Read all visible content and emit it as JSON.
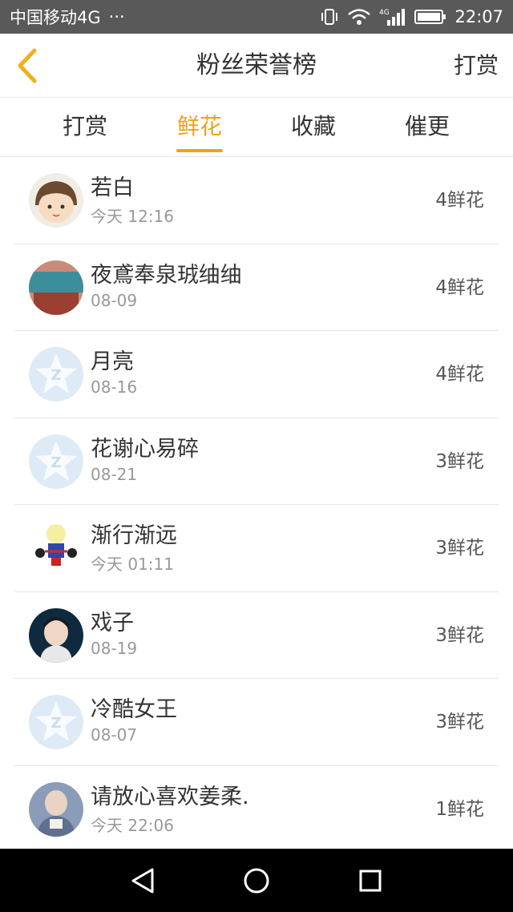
{
  "status_bar": {
    "carrier": "中国移动4G",
    "dots": "···",
    "network": "4G",
    "time": "22:07"
  },
  "header": {
    "title": "粉丝荣誉榜",
    "right_action": "打赏"
  },
  "tabs": [
    {
      "label": "打赏",
      "active": false
    },
    {
      "label": "鲜花",
      "active": true
    },
    {
      "label": "收藏",
      "active": false
    },
    {
      "label": "催更",
      "active": false
    }
  ],
  "accent_color": "#f2a11b",
  "fans": [
    {
      "name": "若白",
      "time": "今天 12:16",
      "count": "4鲜花",
      "avatar": "cartoon-boy-avatar"
    },
    {
      "name": "夜鳶奉泉珬䌷䌷",
      "time": "08-09",
      "count": "4鲜花",
      "avatar": "photo-avatar"
    },
    {
      "name": "月亮",
      "time": "08-16",
      "count": "4鲜花",
      "avatar": "default-star-avatar"
    },
    {
      "name": "花谢心易碎",
      "time": "08-21",
      "count": "3鲜花",
      "avatar": "default-star-avatar"
    },
    {
      "name": "渐行渐远",
      "time": "今天 01:11",
      "count": "3鲜花",
      "avatar": "cartoon-figure-avatar"
    },
    {
      "name": "戏子",
      "time": "08-19",
      "count": "3鲜花",
      "avatar": "portrait-avatar"
    },
    {
      "name": "冷酷女王",
      "time": "08-07",
      "count": "3鲜花",
      "avatar": "default-star-avatar"
    },
    {
      "name": "请放心喜欢姜柔.",
      "time": "今天 22:06",
      "count": "1鲜花",
      "avatar": "photo-avatar"
    }
  ]
}
